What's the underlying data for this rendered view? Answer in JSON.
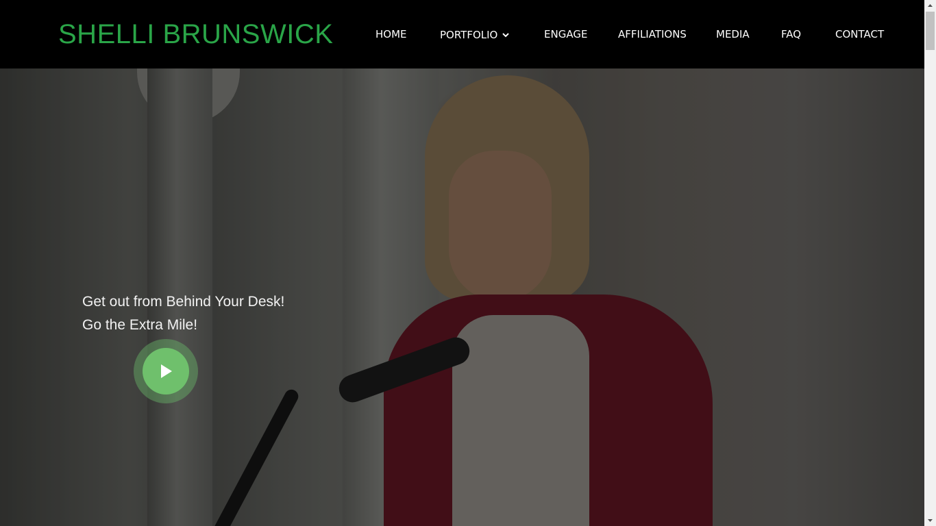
{
  "header": {
    "logo": "SHELLI BRUNSWICK",
    "logo_color": "#2aa548",
    "nav": [
      {
        "label": "HOME"
      },
      {
        "label": "PORTFOLIO",
        "has_dropdown": true,
        "icon": "chevron-down-icon"
      },
      {
        "label": "ENGAGE"
      },
      {
        "label": "AFFILIATIONS"
      },
      {
        "label": "MEDIA"
      },
      {
        "label": "FAQ"
      },
      {
        "label": "CONTACT"
      }
    ]
  },
  "hero": {
    "tagline_line1": "Get out from Behind Your Desk!",
    "tagline_line2": "Go the Extra Mile!",
    "play_icon": "play-icon",
    "play_color": "#6fc06c"
  }
}
